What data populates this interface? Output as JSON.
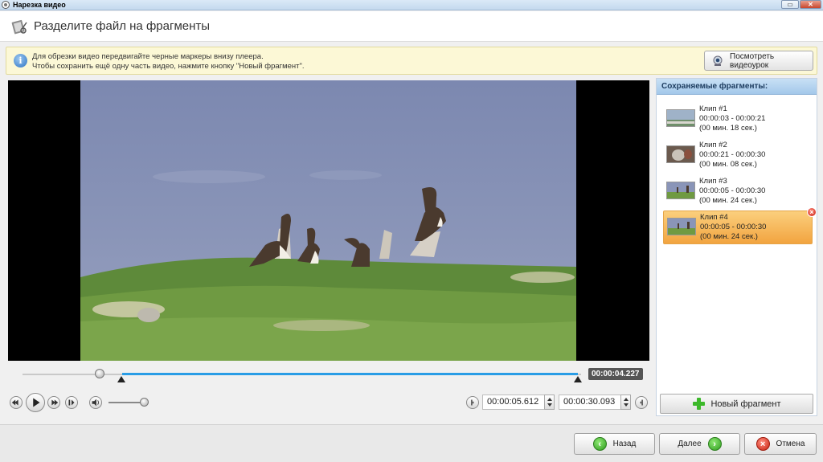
{
  "window": {
    "title": "Нарезка видео"
  },
  "header": {
    "title": "Разделите файл на фрагменты"
  },
  "info": {
    "line1": "Для обрезки видео передвигайте черные маркеры внизу плеера.",
    "line2": "Чтобы сохранить ещё одну часть видео, нажмите кнопку \"Новый фрагмент\".",
    "tutorial_button": "Посмотреть видеоурок"
  },
  "player": {
    "current_time": "00:00:04.227",
    "start_time": "00:00:05.612",
    "end_time": "00:00:30.093",
    "scrub_position": 0.145,
    "volume": 1.0
  },
  "fragments": {
    "header": "Сохраняемые фрагменты:",
    "clips": [
      {
        "name": "Клип #1",
        "range": "00:00:03 - 00:00:21",
        "duration": "(00 мин. 18 сек.)",
        "selected": false
      },
      {
        "name": "Клип #2",
        "range": "00:00:21 - 00:00:30",
        "duration": "(00 мин. 08 сек.)",
        "selected": false
      },
      {
        "name": "Клип #3",
        "range": "00:00:05 - 00:00:30",
        "duration": "(00 мин. 24 сек.)",
        "selected": false
      },
      {
        "name": "Клип #4",
        "range": "00:00:05 - 00:00:30",
        "duration": "(00 мин. 24 сек.)",
        "selected": true
      }
    ],
    "new_button": "Новый фрагмент"
  },
  "footer": {
    "back_label": "Назад",
    "next_label": "Далее",
    "cancel_label": "Отмена"
  },
  "colors": {
    "accent": "#2a9de6",
    "selected_clip": "#f2a440",
    "info_background": "#fcf8d6"
  }
}
